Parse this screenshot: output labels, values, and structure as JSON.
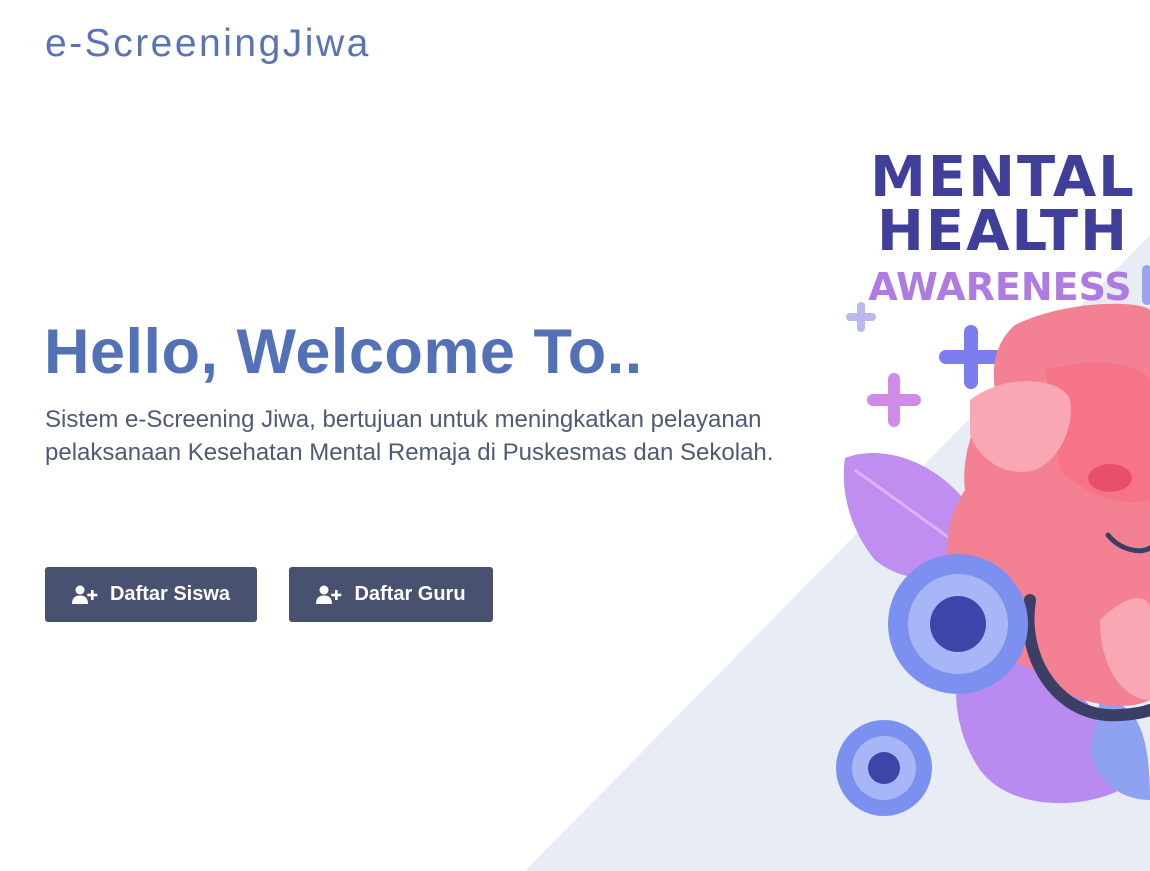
{
  "header": {
    "brand": "e-ScreeningJiwa"
  },
  "hero": {
    "title": "Hello, Welcome To..",
    "description": "Sistem e-Screening Jiwa, bertujuan untuk meningkatkan pelayanan pelaksanaan Kesehatan Mental Remaja di Puskesmas dan Sekolah."
  },
  "buttons": {
    "siswa": {
      "label": "Daftar Siswa",
      "icon": "user-plus-icon"
    },
    "guru": {
      "label": "Daftar Guru",
      "icon": "user-plus-icon"
    }
  },
  "illustration": {
    "line1": "MENTAL",
    "line2": "HEALTH",
    "line3": "AWARENESS"
  },
  "colors": {
    "brand": "#5a73b4",
    "title": "#5271b6",
    "button": "#485270",
    "background_triangle": "#e8ecf5",
    "illustration_heading": "#3f3f9a",
    "illustration_sub": "#b07be0"
  }
}
